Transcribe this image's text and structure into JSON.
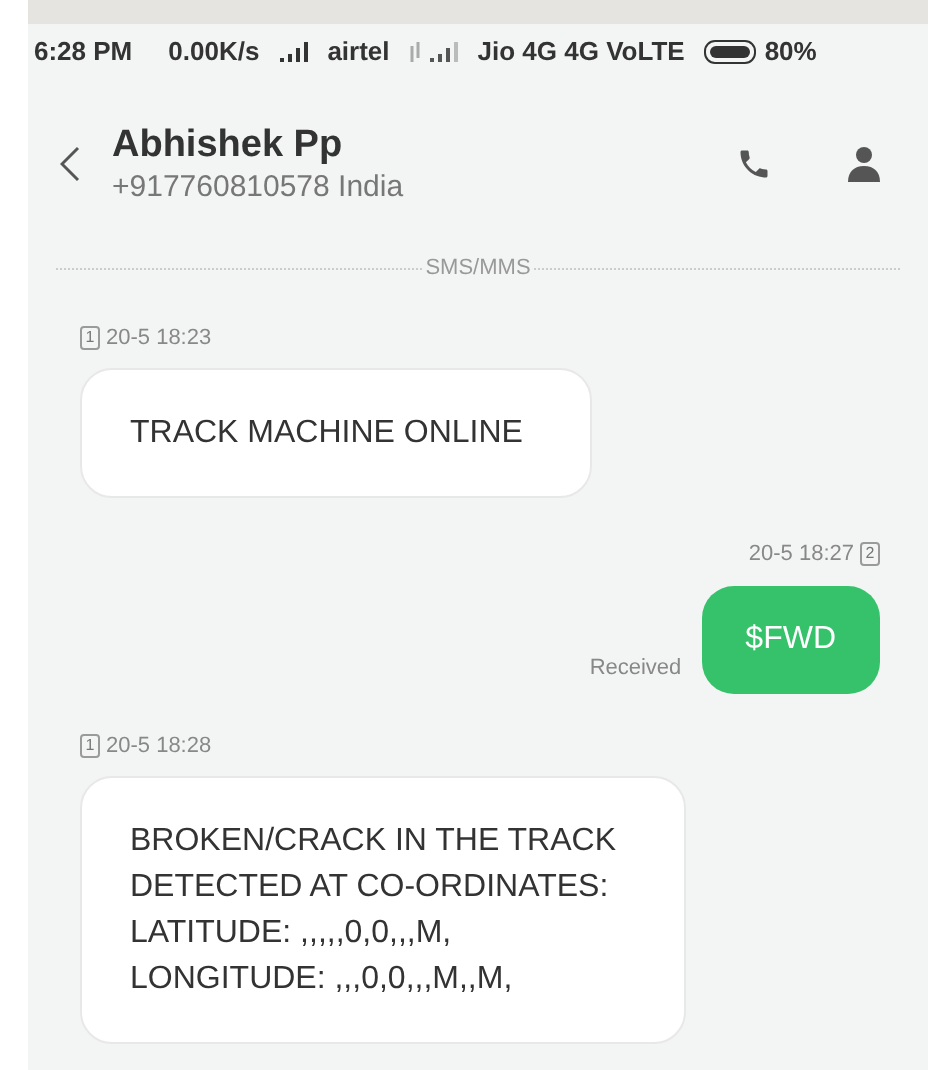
{
  "status_bar": {
    "time": "6:28 PM",
    "speed": "0.00K/s",
    "carrier_1": "airtel",
    "carrier_2": "Jio 4G 4G VoLTE",
    "battery": "80%"
  },
  "header": {
    "name": "Abhishek Pp",
    "number": "+917760810578 India"
  },
  "divider_label": "SMS/MMS",
  "messages": [
    {
      "kind": "incoming",
      "sim": "1",
      "time": "20-5 18:23",
      "lines": [
        "TRACK MACHINE ONLINE"
      ]
    },
    {
      "kind": "outgoing",
      "sim": "2",
      "time": "20-5 18:27",
      "status": "Received",
      "lines": [
        "$FWD"
      ]
    },
    {
      "kind": "incoming",
      "sim": "1",
      "time": "20-5 18:28",
      "lines": [
        "BROKEN/CRACK IN THE TRACK",
        "DETECTED AT CO-ORDINATES:",
        "LATITUDE: ,,,,,0,0,,,M,",
        "LONGITUDE: ,,,0,0,,,M,,M,"
      ]
    }
  ]
}
